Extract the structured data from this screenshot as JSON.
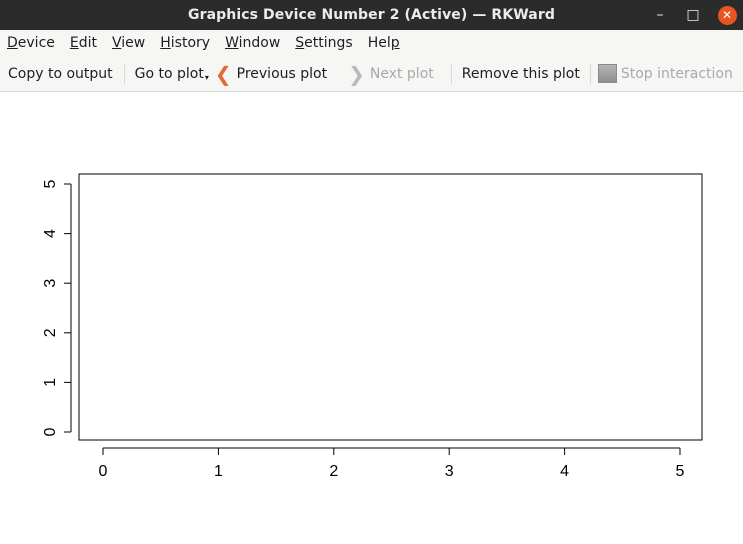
{
  "window": {
    "title": "Graphics Device Number 2 (Active) — RKWard",
    "minimize_glyph": "–",
    "maximize_glyph": "□",
    "close_glyph": "✕"
  },
  "menu": {
    "items": [
      {
        "label": "Device",
        "accel": "D",
        "rest": "evice"
      },
      {
        "label": "Edit",
        "accel": "E",
        "rest": "dit"
      },
      {
        "label": "View",
        "accel": "V",
        "rest": "iew"
      },
      {
        "label": "History",
        "accel": "H",
        "rest": "istory"
      },
      {
        "label": "Window",
        "accel": "W",
        "rest": "indow"
      },
      {
        "label": "Settings",
        "accel": "S",
        "rest": "ettings"
      },
      {
        "label": "Help",
        "pre": "Hel",
        "accel": "p"
      }
    ]
  },
  "toolbar": {
    "copy_to_output": "Copy to output",
    "go_to_plot": "Go to plot",
    "previous_plot": "Previous plot",
    "next_plot": "Next plot",
    "remove_this_plot": "Remove this plot",
    "stop_interaction": "Stop interaction"
  },
  "chart_data": {
    "type": "scatter",
    "x": [],
    "y": [],
    "xlim": [
      0,
      5
    ],
    "ylim": [
      0,
      5
    ],
    "x_ticks": [
      "0",
      "1",
      "2",
      "3",
      "4",
      "5"
    ],
    "y_ticks": [
      "0",
      "1",
      "2",
      "3",
      "4",
      "5"
    ],
    "title": "",
    "xlabel": "",
    "ylabel": "",
    "grid": false,
    "box": true
  }
}
